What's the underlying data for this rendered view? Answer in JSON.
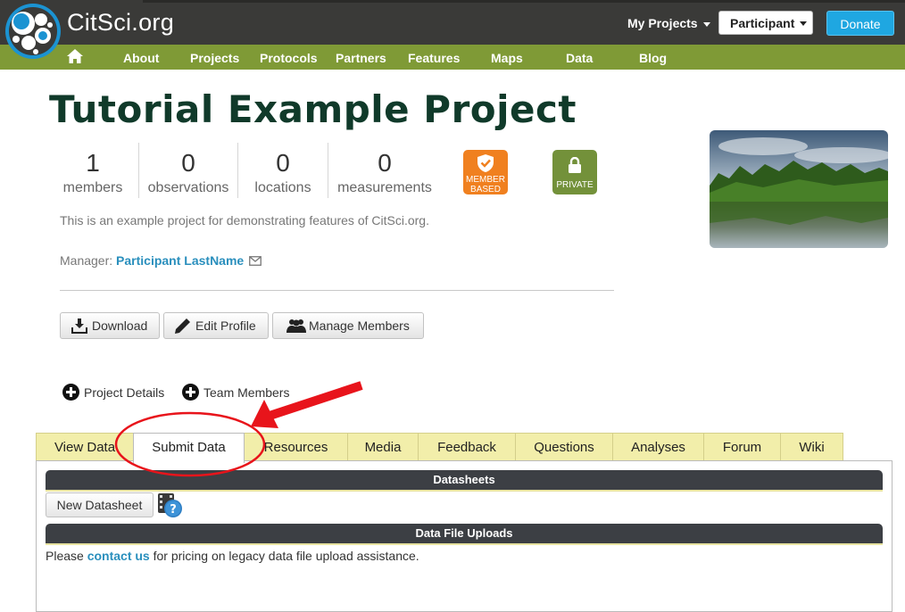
{
  "header": {
    "brand": "CitSci.org",
    "my_projects": "My Projects",
    "role_select": "Participant",
    "donate": "Donate"
  },
  "nav": {
    "items": [
      "About",
      "Projects",
      "Protocols",
      "Partners",
      "Features",
      "Maps",
      "Data",
      "Blog"
    ]
  },
  "project": {
    "title": "Tutorial Example Project",
    "stats": [
      {
        "value": "1",
        "label": "members"
      },
      {
        "value": "0",
        "label": "observations"
      },
      {
        "value": "0",
        "label": "locations"
      },
      {
        "value": "0",
        "label": "measurements"
      }
    ],
    "badges": {
      "member_based": "MEMBER BASED",
      "private": "PRIVATE"
    },
    "description": "This is an example project for demonstrating features of CitSci.org.",
    "manager_label": "Manager:",
    "manager_name": "Participant LastName"
  },
  "actions": {
    "download": "Download",
    "edit_profile": "Edit Profile",
    "manage_members": "Manage Members"
  },
  "expanders": {
    "project_details": "Project Details",
    "team_members": "Team Members"
  },
  "tabs": [
    {
      "label": "View Data",
      "active": false
    },
    {
      "label": "Submit Data",
      "active": true
    },
    {
      "label": "Resources",
      "active": false
    },
    {
      "label": "Media",
      "active": false
    },
    {
      "label": "Feedback",
      "active": false
    },
    {
      "label": "Questions",
      "active": false
    },
    {
      "label": "Analyses",
      "active": false
    },
    {
      "label": "Forum",
      "active": false
    },
    {
      "label": "Wiki",
      "active": false
    }
  ],
  "submit_panel": {
    "datasheets_heading": "Datasheets",
    "new_datasheet": "New Datasheet",
    "uploads_heading": "Data File Uploads",
    "upload_prefix": "Please",
    "upload_link": "contact us",
    "upload_suffix": "for pricing on legacy data file upload assistance."
  },
  "colors": {
    "topbar": "#3a3a38",
    "navbar": "#7f9a36",
    "accent_blue": "#1fa7e1",
    "title_green": "#103a2a",
    "badge_orange": "#f0801f",
    "badge_green": "#73913a",
    "tab_yellow": "#f2eeaa",
    "annotation_red": "#e8141b"
  },
  "icons": [
    "citsci-logo",
    "home-icon",
    "download-icon",
    "pencil-icon",
    "members-icon",
    "plus-circle-icon",
    "shield-check-icon",
    "lock-icon",
    "mail-icon",
    "film-help-icon"
  ]
}
